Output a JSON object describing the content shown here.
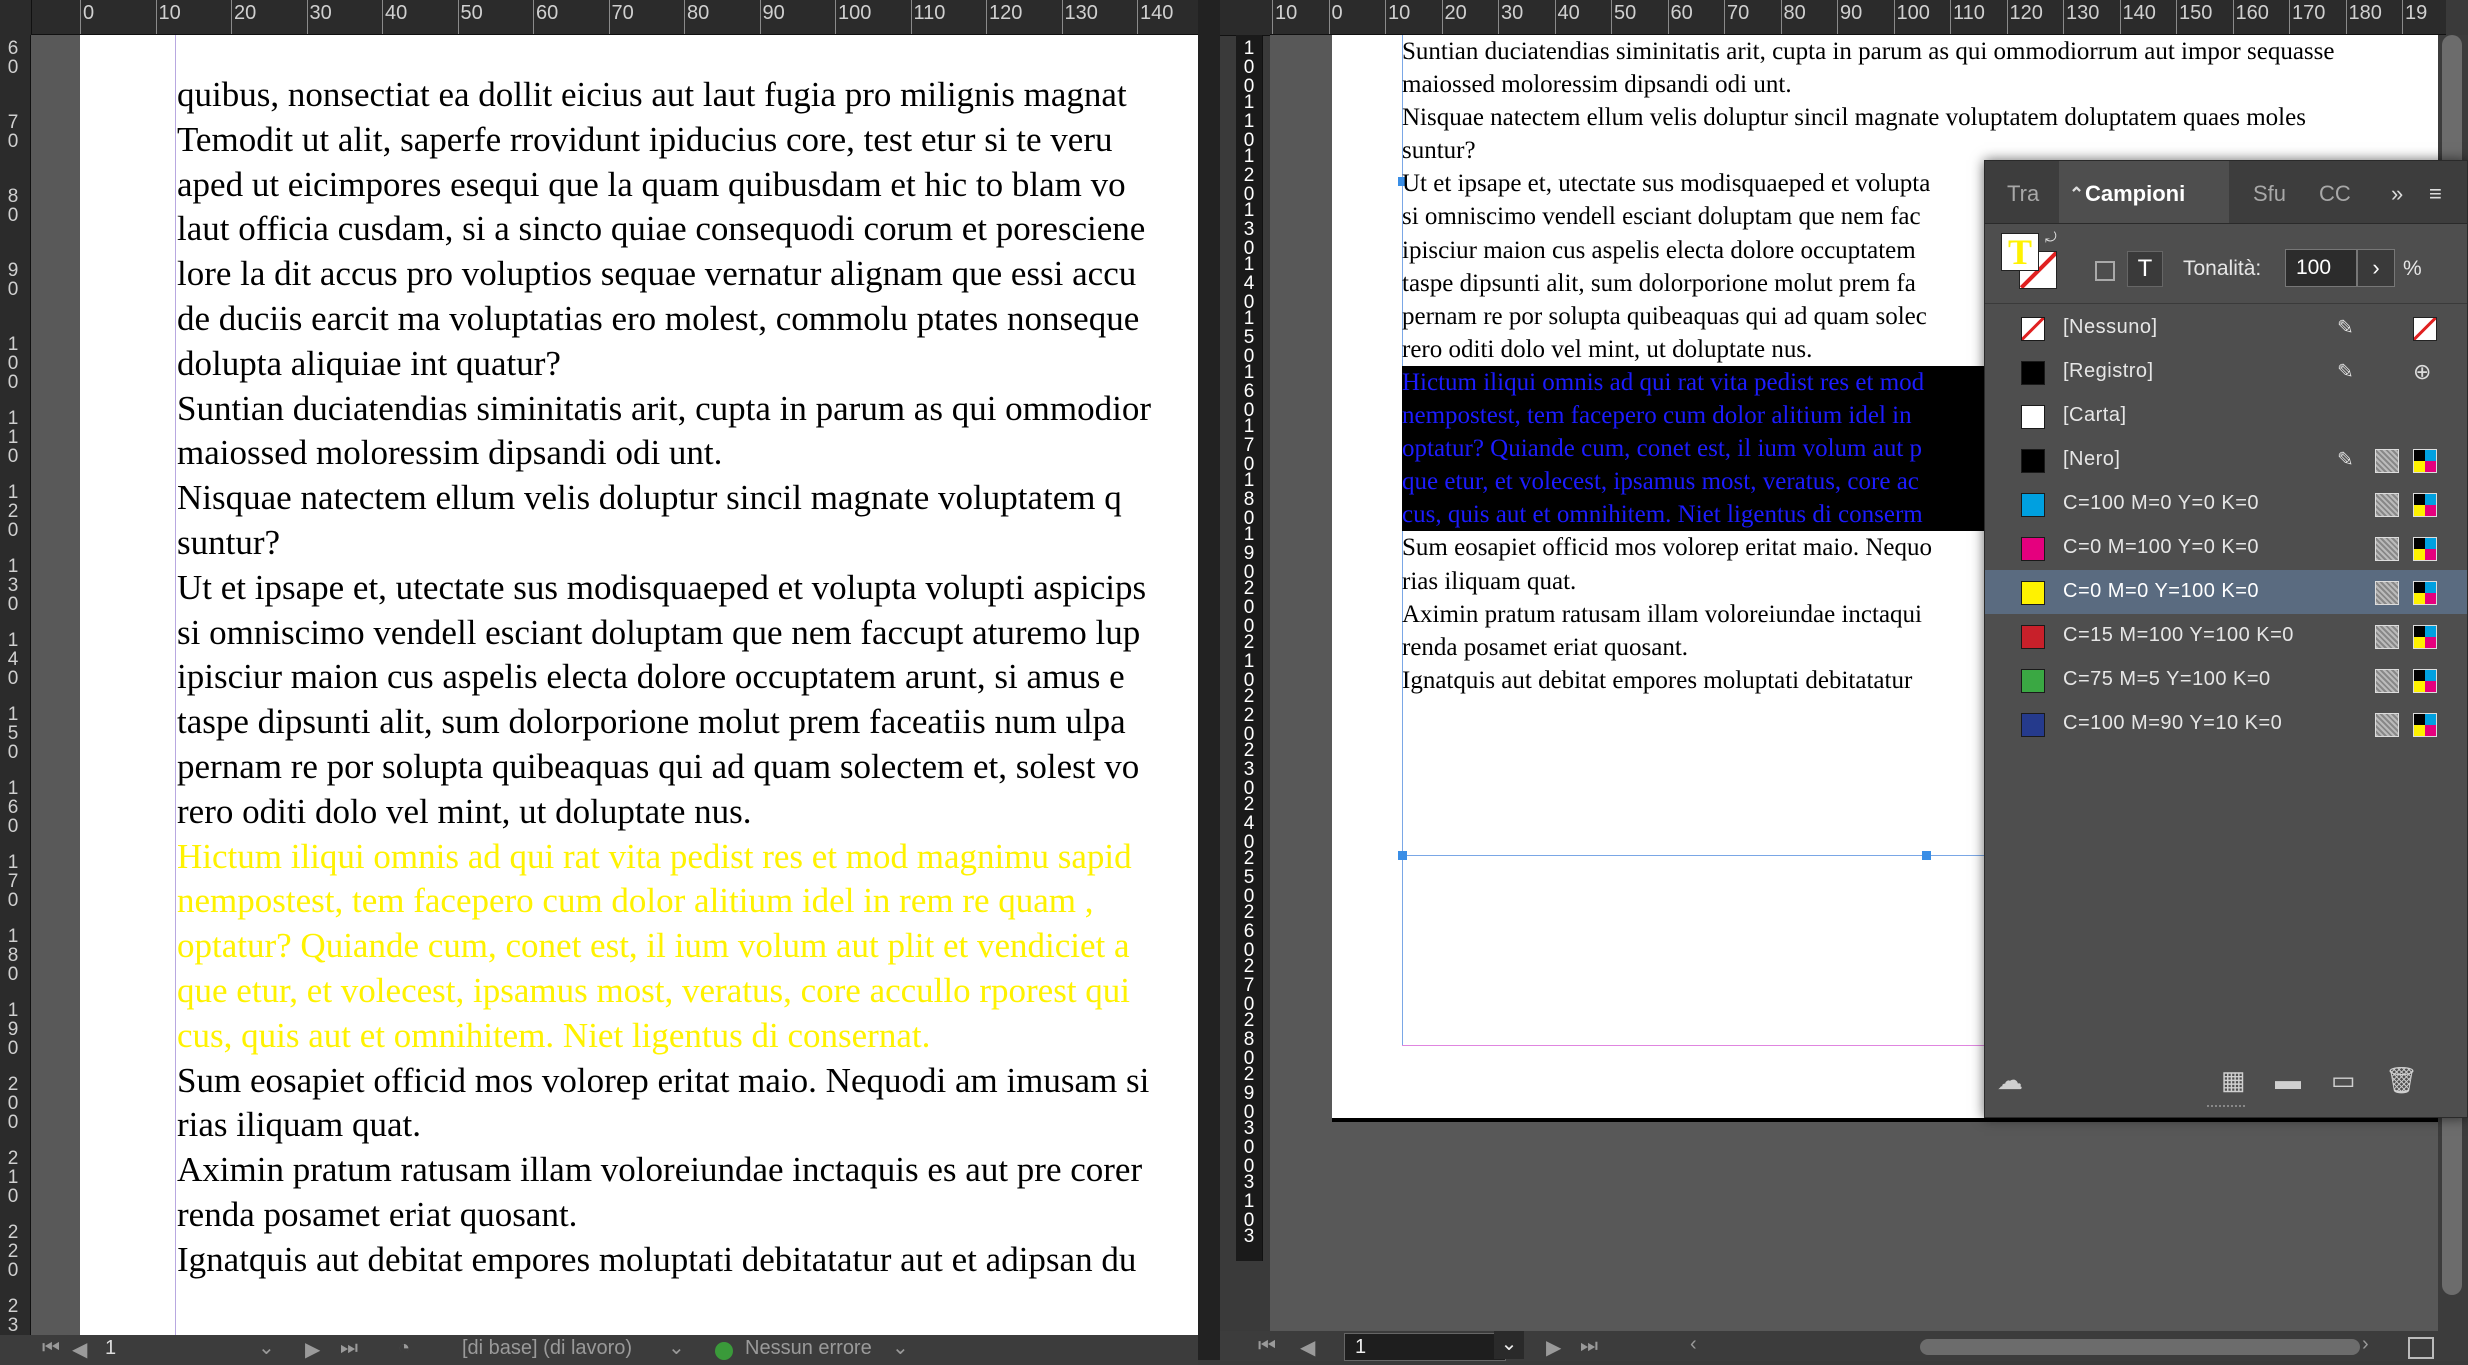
{
  "left_view": {
    "ruler_labels": [
      "0",
      "10",
      "20",
      "30",
      "40",
      "50",
      "60",
      "70",
      "80",
      "90",
      "100",
      "110",
      "120",
      "130",
      "140"
    ],
    "vruler_labels": [
      "6 0",
      "7 0",
      "8 0",
      "9 0",
      "1 0 0",
      "1 1 0",
      "1 2 0",
      "1 3 0",
      "1 4 0",
      "1 5 0",
      "1 6 0",
      "1 7 0",
      "1 8 0",
      "1 9 0",
      "2 0 0",
      "2 1 0",
      "2 2 0",
      "2 3"
    ],
    "paragraphs": [
      {
        "style": "normal",
        "lines": [
          "quibus, nonsectiat ea dollit eicius aut laut fugia pro milignis magnat",
          "Temodit ut alit, saperfe rrovidunt ipiducius core, test etur si te veru",
          "aped ut eicimpores esequi que la quam quibusdam et hic to blam vo",
          "laut officia cusdam, si a sincto quiae consequodi corum et poresciene",
          "lore la dit accus pro voluptios sequae vernatur alignam que essi accu",
          "de duciis earcit ma voluptatias ero molest, commolu ptates nonseque",
          "dolupta aliquiae int quatur?"
        ]
      },
      {
        "style": "normal",
        "lines": [
          "Suntian duciatendias siminitatis arit, cupta in parum as qui ommodior",
          "maiossed moloressim dipsandi odi unt."
        ]
      },
      {
        "style": "normal",
        "lines": [
          "Nisquae natectem ellum velis doluptur sincil magnate voluptatem q",
          "suntur?"
        ]
      },
      {
        "style": "normal",
        "lines": [
          "Ut et ipsape et, utectate sus modisquaeped et volupta volupti aspicips",
          "si omniscimo vendell esciant doluptam que nem faccupt aturemo lup",
          "ipisciur maion cus aspelis electa dolore occuptatem arunt, si amus e",
          "taspe dipsunti alit, sum dolorporione molut prem faceatiis num ulpa",
          "pernam re por solupta quibeaquas qui ad quam solectem et, solest vo",
          "rero oditi dolo vel mint, ut doluptate nus."
        ]
      },
      {
        "style": "yellow",
        "lines": [
          "Hictum iliqui omnis ad qui rat vita pedist res et mod magnimu sapid",
          "nempostest, tem facepero cum dolor alitium idel in rem re quam ,",
          "optatur? Quiande cum, conet est, il ium volum aut plit et vendiciet a",
          "que etur, et volecest, ipsamus most, veratus, core accullo rporest qui",
          "cus, quis aut et omnihitem. Niet ligentus di consernat."
        ]
      },
      {
        "style": "normal",
        "lines": [
          "Sum eosapiet officid mos volorep eritat maio. Nequodi am imusam si",
          "rias iliquam quat."
        ]
      },
      {
        "style": "normal",
        "lines": [
          "Aximin pratum ratusam illam voloreiundae inctaquis es aut pre corer",
          "renda posamet eriat quosant."
        ]
      },
      {
        "style": "normal",
        "lines": [
          "Ignatquis aut debitat empores moluptati debitatatur aut et adipsan du"
        ]
      }
    ],
    "status": {
      "page": "1",
      "master": "[di base] (di lavoro)",
      "errors": "Nessun errore"
    }
  },
  "right_view": {
    "ruler_labels": [
      "10",
      "0",
      "10",
      "20",
      "30",
      "40",
      "50",
      "60",
      "70",
      "80",
      "90",
      "100",
      "110",
      "120",
      "130",
      "140",
      "150",
      "160",
      "170",
      "180",
      "19"
    ],
    "vruler_labels": [
      "1 0 0",
      "1 1 0",
      "1 2 0",
      "1 3 0",
      "1 4 0",
      "1 5 0",
      "1 6 0",
      "1 7 0",
      "1 8 0",
      "1 9 0",
      "2 0 0",
      "2 1 0",
      "2 2 0",
      "2 3 0",
      "2 4 0",
      "2 5 0",
      "2 6 0",
      "2 7 0",
      "2 8 0",
      "2 9 0",
      "3 0 0",
      "3 1 0",
      "3"
    ],
    "paragraphs": [
      {
        "style": "normal",
        "lines": [
          "Suntian duciatendias siminitatis arit, cupta in parum as qui ommodiorrum aut impor sequasse",
          "maiossed moloressim dipsandi odi unt."
        ]
      },
      {
        "style": "normal",
        "lines": [
          "Nisquae natectem ellum velis doluptur sincil magnate voluptatem doluptatem quaes moles",
          "suntur?"
        ]
      },
      {
        "style": "normal",
        "lines": [
          "Ut et ipsape et, utectate sus modisquaeped et volupta",
          "si omniscimo vendell esciant doluptam que nem fac",
          "ipisciur maion cus aspelis electa dolore occuptatem",
          "taspe dipsunti alit, sum dolorporione molut prem fa",
          "pernam re por solupta quibeaquas qui ad quam solec",
          "rero oditi dolo vel mint, ut doluptate nus."
        ]
      },
      {
        "style": "highlight",
        "lines": [
          "Hictum iliqui omnis ad qui rat vita pedist res et mod",
          "nempostest, tem facepero cum dolor alitium idel in",
          "optatur? Quiande cum, conet est, il ium volum aut p",
          "que etur, et volecest, ipsamus most, veratus, core ac",
          "cus, quis aut et omnihitem. Niet ligentus di conserm"
        ]
      },
      {
        "style": "normal",
        "lines": [
          "Sum eosapiet officid mos volorep eritat maio. Nequo",
          "rias iliquam quat."
        ]
      },
      {
        "style": "normal",
        "lines": [
          "Aximin pratum ratusam illam voloreiundae inctaqui",
          "renda posamet eriat quosant."
        ]
      },
      {
        "style": "normal",
        "lines": [
          "Ignatquis aut debitat empores moluptati debitatatur"
        ]
      }
    ],
    "status": {
      "page": "1"
    }
  },
  "swatches_panel": {
    "tabs": [
      "Tra",
      "Campioni",
      "Sfu",
      "CC"
    ],
    "active_tab": "Campioni",
    "tint_label": "Tonalità:",
    "tint_value": "100",
    "tint_unit": "%",
    "text_mode_glyph": "T",
    "swatches": [
      {
        "name": "[Nessuno]",
        "color": "none",
        "selected": false,
        "icons": [
          "pencil-off",
          "none"
        ]
      },
      {
        "name": "[Registro]",
        "color": "#000000",
        "selected": false,
        "icons": [
          "pencil-off",
          "registration"
        ]
      },
      {
        "name": "[Carta]",
        "color": "#ffffff",
        "selected": false,
        "icons": []
      },
      {
        "name": "[Nero]",
        "color": "#000000",
        "selected": false,
        "icons": [
          "pencil-off",
          "process",
          "cmyk"
        ]
      },
      {
        "name": "C=100 M=0 Y=0 K=0",
        "color": "#00a0e0",
        "selected": false,
        "icons": [
          "process",
          "cmyk"
        ]
      },
      {
        "name": "C=0 M=100 Y=0 K=0",
        "color": "#e5007e",
        "selected": false,
        "icons": [
          "process",
          "cmyk"
        ]
      },
      {
        "name": "C=0 M=0 Y=100 K=0",
        "color": "#fff200",
        "selected": true,
        "icons": [
          "process",
          "cmyk"
        ]
      },
      {
        "name": "C=15 M=100 Y=100 K=0",
        "color": "#c8202a",
        "selected": false,
        "icons": [
          "process",
          "cmyk"
        ]
      },
      {
        "name": "C=75 M=5 Y=100 K=0",
        "color": "#3aa843",
        "selected": false,
        "icons": [
          "process",
          "cmyk"
        ]
      },
      {
        "name": "C=100 M=90 Y=10 K=0",
        "color": "#253a8c",
        "selected": false,
        "icons": [
          "process",
          "cmyk"
        ]
      }
    ]
  }
}
